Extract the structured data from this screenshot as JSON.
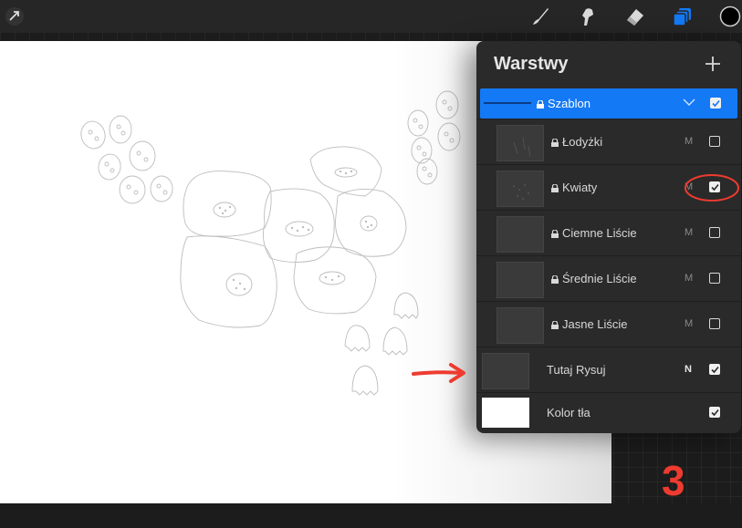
{
  "toolbar": {
    "tools": [
      {
        "name": "brush-icon"
      },
      {
        "name": "smudge-icon"
      },
      {
        "name": "eraser-icon"
      },
      {
        "name": "layers-icon",
        "active": true
      },
      {
        "name": "color-swatch",
        "color": "#000000"
      }
    ]
  },
  "layers_panel": {
    "title": "Warstwy",
    "add_icon": "plus-icon",
    "layers": [
      {
        "label": "Szablon",
        "locked": true,
        "selected": true,
        "visible": true,
        "mode": ""
      },
      {
        "label": "Łodyżki",
        "locked": true,
        "selected": false,
        "visible": false,
        "mode": "M"
      },
      {
        "label": "Kwiaty",
        "locked": true,
        "selected": false,
        "visible": true,
        "mode": "M"
      },
      {
        "label": "Ciemne Liście",
        "locked": true,
        "selected": false,
        "visible": false,
        "mode": "M"
      },
      {
        "label": "Średnie Liście",
        "locked": true,
        "selected": false,
        "visible": false,
        "mode": "M"
      },
      {
        "label": "Jasne Liście",
        "locked": true,
        "selected": false,
        "visible": false,
        "mode": "M"
      },
      {
        "label": "Tutaj Rysuj",
        "locked": false,
        "selected": false,
        "visible": true,
        "mode": "N"
      },
      {
        "label": "Kolor tła",
        "locked": false,
        "selected": false,
        "visible": true,
        "mode": ""
      }
    ]
  },
  "annotation": {
    "step": "3",
    "accent_color": "#ee3b30"
  },
  "colors": {
    "selected_row": "#1479f5",
    "panel": "#2a2a2a",
    "canvas": "#ffffff"
  }
}
